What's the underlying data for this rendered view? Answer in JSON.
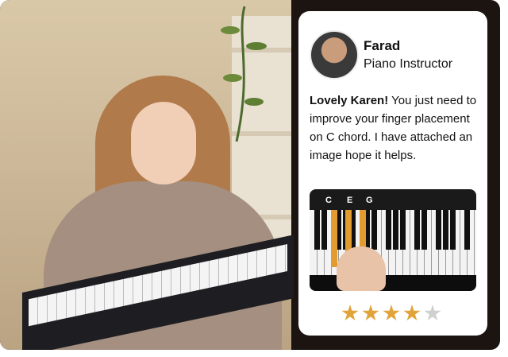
{
  "photo": {
    "description_icon": "woman-playing-keyboard-photo"
  },
  "card": {
    "instructor_name": "Farad",
    "instructor_role": "Piano Instructor",
    "message_greeting": "Lovely Karen!",
    "message_body": " You just need to improve your finger placement on C chord. I have attached an image hope it helps.",
    "chord_labels": [
      "C",
      "E",
      "G"
    ],
    "rating": {
      "value": 4,
      "max": 5
    },
    "colors": {
      "star_filled": "#e2a33a",
      "star_empty": "#cfcfcf",
      "highlight": "#e19b2e"
    }
  }
}
